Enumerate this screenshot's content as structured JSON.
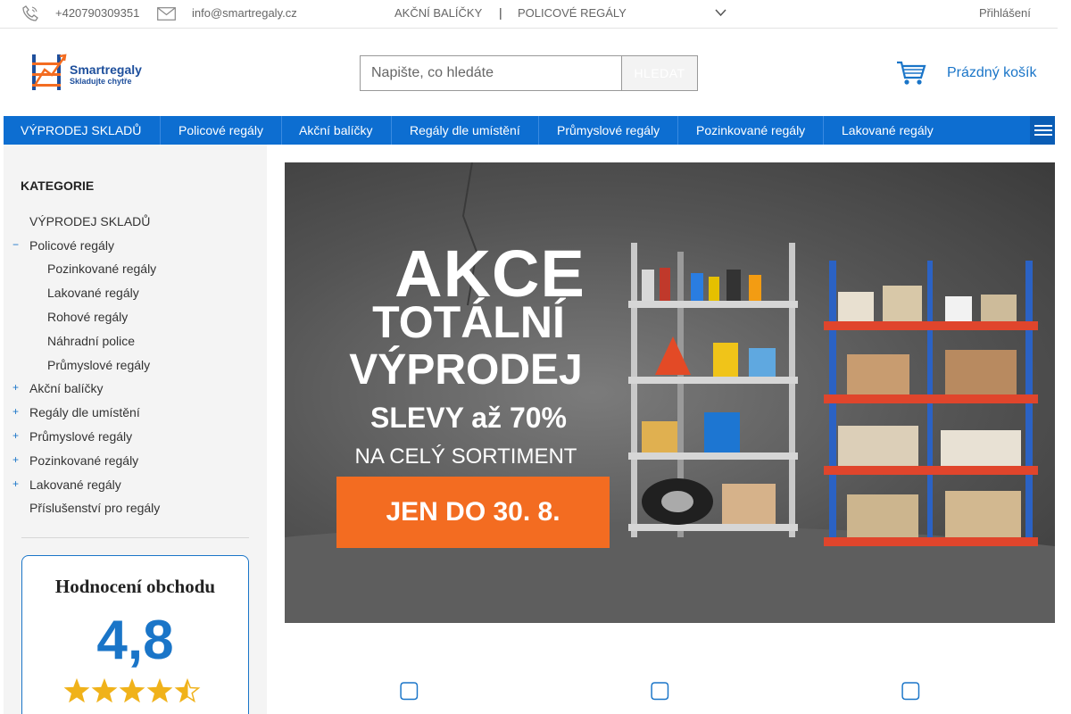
{
  "topbar": {
    "phone": "+420790309351",
    "email": "info@smartregaly.cz",
    "link_akcni": "AKČNÍ BALÍČKY",
    "separator": "|",
    "link_policove": "POLICOVÉ REGÁLY",
    "login": "Přihlášení"
  },
  "header": {
    "logo_name": "Smartregaly",
    "logo_tagline": "Skladujte chytře",
    "search_placeholder": "Napište, co hledáte",
    "search_button": "HLEDAT",
    "cart_label": "Prázdný košík"
  },
  "nav": {
    "items": [
      "VÝPRODEJ SKLADŮ",
      "Policové regály",
      "Akční balíčky",
      "Regály dle umístění",
      "Průmyslové regály",
      "Pozinkované regály",
      "Lakované regály"
    ]
  },
  "sidebar": {
    "title": "KATEGORIE",
    "categories": [
      {
        "label": "VÝPRODEJ SKLADŮ",
        "toggle": ""
      },
      {
        "label": "Policové regály",
        "toggle": "−"
      },
      {
        "label": "Pozinkované regály",
        "toggle": ""
      },
      {
        "label": "Lakované regály",
        "toggle": ""
      },
      {
        "label": "Rohové regály",
        "toggle": ""
      },
      {
        "label": "Náhradní police",
        "toggle": ""
      },
      {
        "label": "Průmyslové regály",
        "toggle": ""
      },
      {
        "label": "Akční balíčky",
        "toggle": "+"
      },
      {
        "label": "Regály dle umístění",
        "toggle": "+"
      },
      {
        "label": "Průmyslové regály",
        "toggle": "+"
      },
      {
        "label": "Pozinkované regály",
        "toggle": "+"
      },
      {
        "label": "Lakované regály",
        "toggle": "+"
      },
      {
        "label": "Příslušenství pro regály",
        "toggle": ""
      }
    ],
    "rating": {
      "title": "Hodnocení obchodu",
      "value": "4,8",
      "stars": 4.5
    }
  },
  "banner": {
    "line1": "AKCE",
    "line2": "TOTÁLNÍ",
    "line3": "VÝPRODEJ",
    "line4": "SLEVY až 70%",
    "line5": "NA CELÝ SORTIMENT",
    "badge": "JEN DO 30. 8."
  },
  "colors": {
    "accent": "#0d6ed1",
    "link": "#1a75c8",
    "badge": "#f36c21",
    "star": "#f0b21a"
  }
}
